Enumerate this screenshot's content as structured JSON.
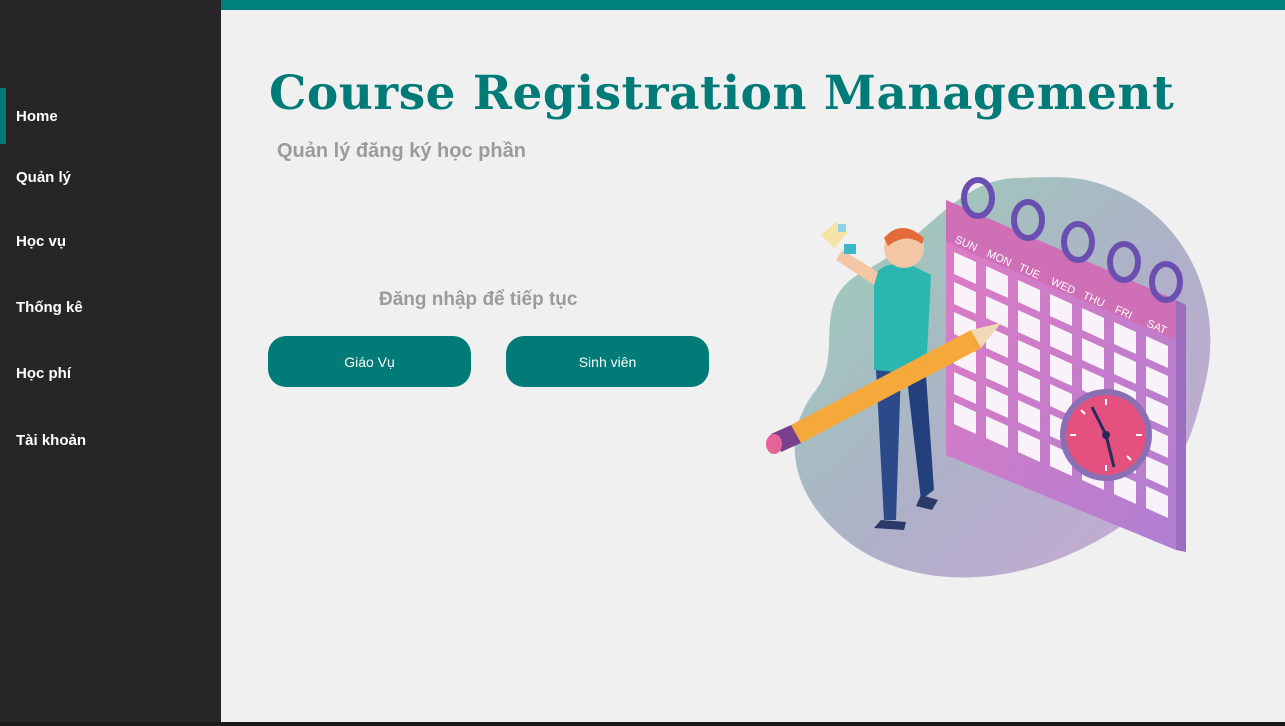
{
  "sidebar": {
    "items": [
      {
        "label": "Home",
        "active": true
      },
      {
        "label": "Quản lý"
      },
      {
        "label": "Học vụ"
      },
      {
        "label": "Thống kê"
      },
      {
        "label": "Học phí"
      },
      {
        "label": "Tài khoản"
      }
    ]
  },
  "main": {
    "title": "Course Registration Management",
    "subtitle": "Quản lý đăng ký học phần",
    "login_prompt": "Đăng nhập để tiếp tục",
    "buttons": {
      "staff": "Giáo Vụ",
      "student": "Sinh viên"
    }
  },
  "illustration": {
    "weekdays": [
      "SUN",
      "MON",
      "TUE",
      "WED",
      "THU",
      "FRI",
      "SAT"
    ]
  },
  "colors": {
    "accent": "#007b78",
    "sidebar_bg": "#272527",
    "main_bg": "#f0f0f0"
  }
}
